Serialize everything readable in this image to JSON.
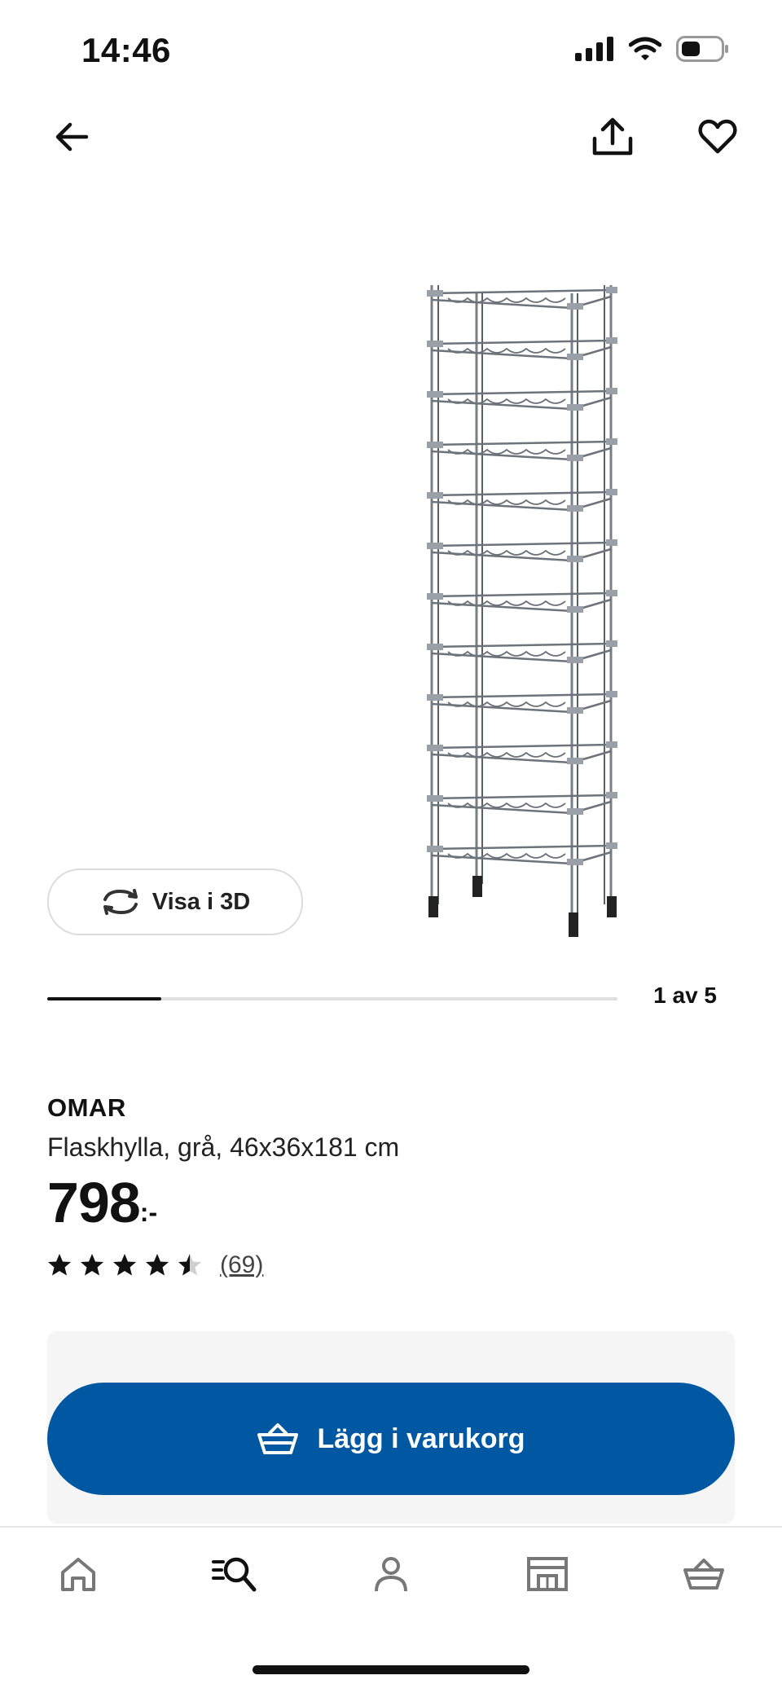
{
  "status_bar": {
    "time": "14:46"
  },
  "header": {
    "back_icon": "arrow-left-icon",
    "share_icon": "share-icon",
    "favorite_icon": "heart-icon"
  },
  "gallery": {
    "view_3d_label": "Visa i 3D",
    "page_indicator": "1 av 5",
    "progress": 0.2
  },
  "product": {
    "name": "OMAR",
    "description": "Flaskhylla, grå, 46x36x181 cm",
    "price": "798",
    "price_suffix": ":-",
    "rating": 4.5,
    "review_count": "(69)"
  },
  "cart": {
    "add_to_cart_label": "Lägg i varukorg"
  },
  "bottom_nav": {
    "items": [
      {
        "icon": "home-icon"
      },
      {
        "icon": "search-icon"
      },
      {
        "icon": "profile-icon"
      },
      {
        "icon": "store-icon"
      },
      {
        "icon": "basket-icon"
      }
    ]
  },
  "colors": {
    "primary_blue": "#0058a3",
    "panel_bg": "#f5f5f5"
  }
}
